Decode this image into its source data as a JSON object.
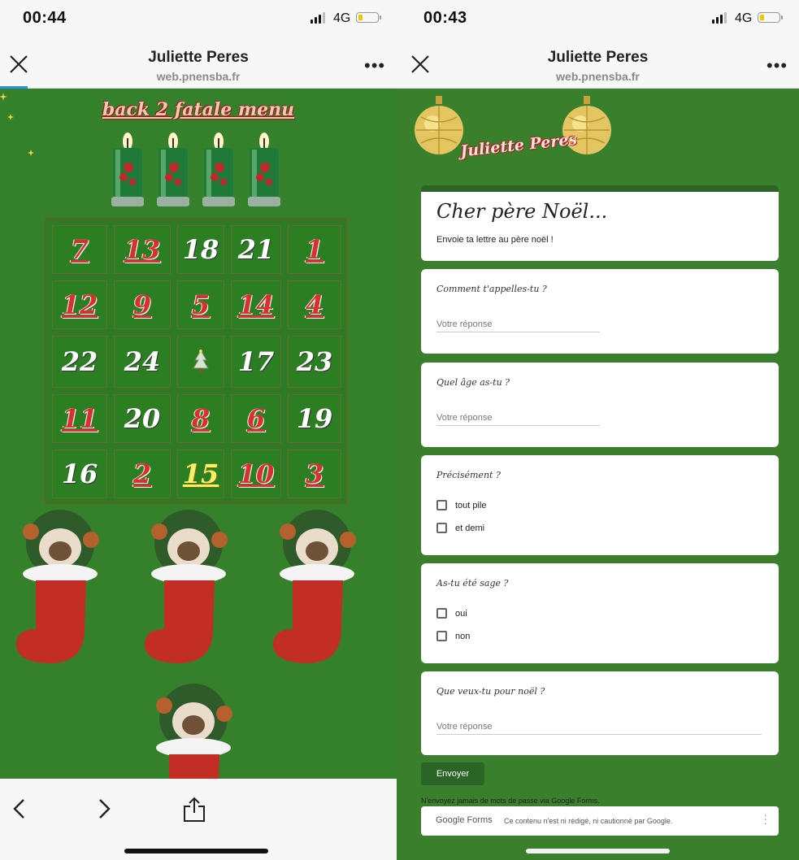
{
  "left": {
    "status": {
      "time": "00:44",
      "network": "4G"
    },
    "nav": {
      "title": "Juliette Peres",
      "url": "web.pnensba.fr"
    },
    "back_link": "back 2 fatale menu",
    "calendar": {
      "rows": [
        [
          {
            "n": "7",
            "style": "red"
          },
          {
            "n": "13",
            "style": "red"
          },
          {
            "n": "18",
            "style": "white"
          },
          {
            "n": "21",
            "style": "white"
          },
          {
            "n": "1",
            "style": "red"
          }
        ],
        [
          {
            "n": "12",
            "style": "red"
          },
          {
            "n": "9",
            "style": "red"
          },
          {
            "n": "5",
            "style": "red"
          },
          {
            "n": "14",
            "style": "red"
          },
          {
            "n": "4",
            "style": "red"
          }
        ],
        [
          {
            "n": "22",
            "style": "white"
          },
          {
            "n": "24",
            "style": "white"
          },
          {
            "n": "",
            "style": "tree"
          },
          {
            "n": "17",
            "style": "white"
          },
          {
            "n": "23",
            "style": "white"
          }
        ],
        [
          {
            "n": "11",
            "style": "red"
          },
          {
            "n": "20",
            "style": "white"
          },
          {
            "n": "8",
            "style": "red"
          },
          {
            "n": "6",
            "style": "red"
          },
          {
            "n": "19",
            "style": "white"
          }
        ],
        [
          {
            "n": "16",
            "style": "white"
          },
          {
            "n": "2",
            "style": "red"
          },
          {
            "n": "15",
            "style": "yellow"
          },
          {
            "n": "10",
            "style": "red"
          },
          {
            "n": "3",
            "style": "red"
          }
        ]
      ]
    }
  },
  "right": {
    "status": {
      "time": "00:43",
      "network": "4G"
    },
    "nav": {
      "title": "Juliette Peres",
      "url": "web.pnensba.fr"
    },
    "banner_name": "Juliette Peres",
    "form": {
      "title": "Cher père Noël...",
      "description": "Envoie ta lettre au père noël !",
      "q1": {
        "label": "Comment t'appelles-tu ?",
        "placeholder": "Votre réponse"
      },
      "q2": {
        "label": "Quel âge as-tu ?",
        "placeholder": "Votre réponse"
      },
      "q3": {
        "label": "Précisément ?",
        "options": [
          "tout pile",
          "et demi"
        ]
      },
      "q4": {
        "label": "As-tu été sage ?",
        "options": [
          "oui",
          "non"
        ]
      },
      "q5": {
        "label": "Que veux-tu pour noël ?",
        "placeholder": "Votre réponse"
      },
      "submit": "Envoyer",
      "notice": "N'envoyez jamais de mots de passe via Google Forms.",
      "footer_logo": "Google Forms",
      "footer_text": "Ce contenu n'est ni rédigé, ni cautionné par Google."
    }
  },
  "colors": {
    "background_green": "#3a7f2c",
    "submit_green": "#2a6426",
    "link_blue": "#2f8de4"
  }
}
